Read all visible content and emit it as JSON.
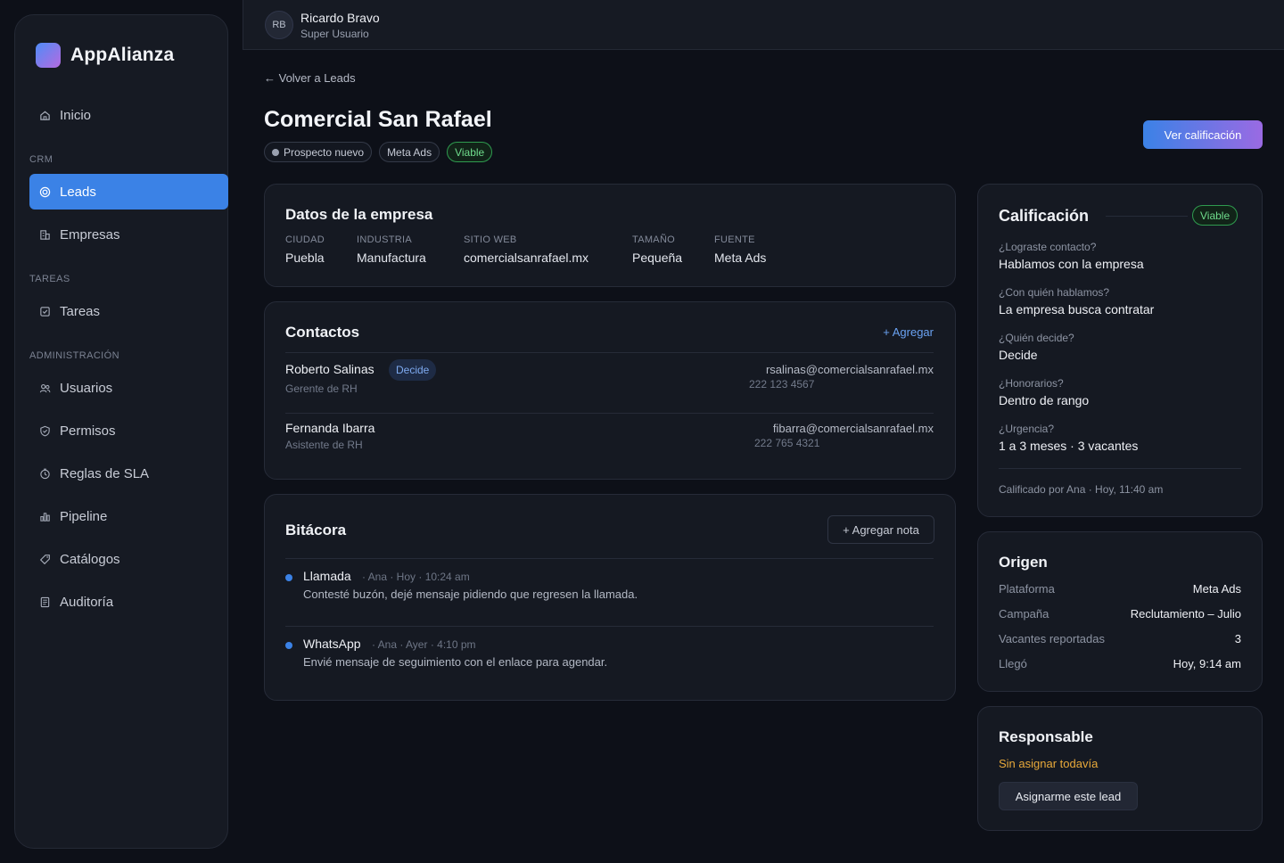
{
  "app": {
    "name": "AppAlianza"
  },
  "sidebar": {
    "sections": [
      "CRM",
      "TAREAS",
      "ADMINISTRACIÓN"
    ],
    "items": [
      {
        "label": "Inicio",
        "icon": "home-icon",
        "active": false
      },
      {
        "label": "Leads",
        "icon": "target-icon",
        "active": true
      },
      {
        "label": "Empresas",
        "icon": "building-icon",
        "active": false
      },
      {
        "label": "Tareas",
        "icon": "checklist-icon",
        "active": false
      },
      {
        "label": "Usuarios",
        "icon": "users-icon",
        "active": false
      },
      {
        "label": "Permisos",
        "icon": "shield-icon",
        "active": false
      },
      {
        "label": "Reglas de SLA",
        "icon": "clock-icon",
        "active": false
      },
      {
        "label": "Pipeline",
        "icon": "bar-chart-icon",
        "active": false
      },
      {
        "label": "Catálogos",
        "icon": "tag-icon",
        "active": false
      },
      {
        "label": "Auditoría",
        "icon": "document-icon",
        "active": false
      }
    ]
  },
  "user": {
    "initials": "RB",
    "name": "Ricardo Bravo",
    "role": "Super Usuario"
  },
  "header": {
    "back": "← Volver a Leads",
    "title": "Comercial San Rafael",
    "chips": [
      "Prospecto nuevo",
      "Meta Ads",
      "Viable"
    ],
    "action": "Ver calificación"
  },
  "company": {
    "title": "Datos de la empresa",
    "fields": [
      {
        "label": "CIUDAD",
        "value": "Puebla"
      },
      {
        "label": "INDUSTRIA",
        "value": "Manufactura"
      },
      {
        "label": "SITIO WEB",
        "value": "comercialsanrafael.mx"
      },
      {
        "label": "TAMAÑO",
        "value": "Pequeña"
      },
      {
        "label": "FUENTE",
        "value": "Meta Ads"
      }
    ]
  },
  "contacts": {
    "title": "Contactos",
    "add": "+ Agregar",
    "items": [
      {
        "name": "Roberto Salinas",
        "badge": "Decide",
        "role": "Gerente de RH",
        "email": "rsalinas@comercialsanrafael.mx",
        "phone": "222 123 4567"
      },
      {
        "name": "Fernanda Ibarra",
        "badge": "",
        "role": "Asistente de RH",
        "email": "fibarra@comercialsanrafael.mx",
        "phone": "222 765 4321"
      }
    ]
  },
  "log": {
    "title": "Bitácora",
    "add": "+ Agregar nota",
    "items": [
      {
        "type": "Llamada",
        "meta": "· Ana · Hoy · 10:24 am",
        "text": "Contesté buzón, dejé mensaje pidiendo que regresen la llamada."
      },
      {
        "type": "WhatsApp",
        "meta": "· Ana · Ayer · 4:10 pm",
        "text": "Envié mensaje de seguimiento con el enlace para agendar."
      }
    ]
  },
  "qualification": {
    "title": "Calificación",
    "badge": "Viable",
    "questions": [
      {
        "q": "¿Lograste contacto?",
        "a": "Hablamos con la empresa"
      },
      {
        "q": "¿Con quién hablamos?",
        "a": "La empresa busca contratar"
      },
      {
        "q": "¿Quién decide?",
        "a": "Decide"
      },
      {
        "q": "¿Honorarios?",
        "a": "Dentro de rango"
      },
      {
        "q": "¿Urgencia?",
        "a": "1 a 3 meses · 3 vacantes"
      }
    ],
    "footer": "Calificado por Ana · Hoy, 11:40 am"
  },
  "origin": {
    "title": "Origen",
    "rows": [
      {
        "key": "Plataforma",
        "value": "Meta Ads"
      },
      {
        "key": "Campaña",
        "value": "Reclutamiento – Julio"
      },
      {
        "key": "Vacantes reportadas",
        "value": "3"
      },
      {
        "key": "Llegó",
        "value": "Hoy, 9:14 am"
      }
    ]
  },
  "owner": {
    "title": "Responsable",
    "status": "Sin asignar todavía",
    "action": "Asignarme este lead"
  },
  "colors": {
    "accent": "#3b82e6",
    "viable": "#6fdc8c",
    "warning": "#e8a93a",
    "background": "#0d1018"
  }
}
